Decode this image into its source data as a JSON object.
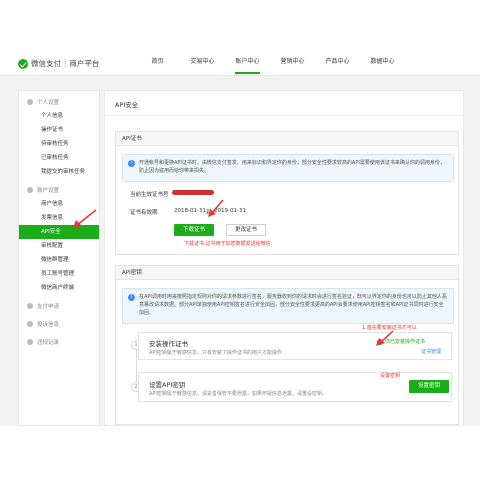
{
  "header": {
    "brand": "微信支付",
    "brand_sub": "商户平台",
    "nav": [
      {
        "label": "首页"
      },
      {
        "label": "交易中心"
      },
      {
        "label": "账户中心",
        "active": true
      },
      {
        "label": "营销中心"
      },
      {
        "label": "产品中心"
      },
      {
        "label": "数据中心"
      }
    ]
  },
  "sidebar": {
    "group_personal": "个人设置",
    "personal_items": [
      "个人信息",
      "操作证书",
      "待审核任务",
      "已审核任务",
      "我提交的审核任务"
    ],
    "group_account": "账户设置",
    "account_items": [
      "商户信息",
      "发票信息",
      "API安全",
      "审核配置",
      "微信群管理",
      "员工账号管理",
      "微信商户终端"
    ],
    "active_item": "API安全",
    "group_pay": "支付申请",
    "group_complaint": "投诉信息",
    "group_violation": "违规记录"
  },
  "main": {
    "title": "API安全",
    "cert_card": {
      "head": "API证书",
      "notice": "开通帐号和更换API证书时，由微信支付签发、用来标识和界定你的身份；部分安全性要求较高的API需要使用该证书来确认你的调用身份，防止因为盗用而给你带来损失。",
      "serial_label": "当前生效证书号",
      "validity_label": "证书有效期",
      "validity_from": "2018-01-31",
      "validity_to_word": "到",
      "validity_to": "2019-01-31",
      "download_btn": "下载证书",
      "change_btn": "更改证书",
      "red_note": "下载证书,证书用于加密数据发送给微信"
    },
    "key_card": {
      "head": "API密钥",
      "notice": "在API调用时用来按照指定规则对你的请求参数进行签名，服务器收到你的请求时会进行签名验证，既可以界定你的身份也可以防止其他人恶意篡改请求数据。部分API单独使用API密钥签名进行安全加固，部分安全性要求更高的API会要求使用API密钥签名和API证书同时进行安全加固。",
      "step1": {
        "num": "1",
        "title": "安装操作证书",
        "desc": "API密钥属于敏感信息，只有安装了操作证书的用户才能操作",
        "status": "你已安装操作证书",
        "link": "证书管理",
        "red_note": "1.首先要安装证书才可以"
      },
      "step2": {
        "num": "2",
        "title": "设置API密钥",
        "desc": "API密钥属于敏感信息，请妥善保管不要泄露，如果怀疑信息泄露，请重设密钥。",
        "button": "设置密钥",
        "red_note": "设置密钥"
      }
    }
  },
  "colors": {
    "accent": "#1aad19",
    "annotation": "#e53935",
    "info": "#3a8ee6"
  }
}
